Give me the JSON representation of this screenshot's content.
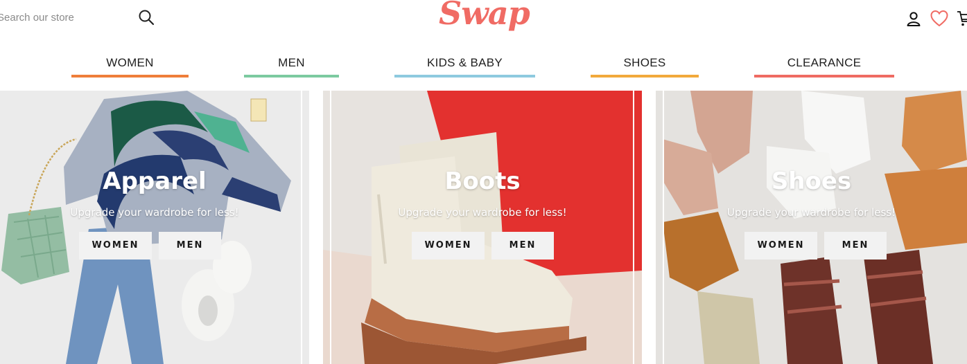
{
  "search": {
    "placeholder": "Search our store",
    "icon": "search-icon"
  },
  "brand": {
    "logo_text": "Swap",
    "color": "#f06b64"
  },
  "header_icons": [
    "account-icon",
    "heart-icon",
    "cart-icon"
  ],
  "nav": [
    {
      "label": "WOMEN",
      "color": "#ef7e3a"
    },
    {
      "label": "MEN",
      "color": "#7ccaa0"
    },
    {
      "label": "KIDS & BABY",
      "color": "#8ecadf"
    },
    {
      "label": "SHOES",
      "color": "#f2a93b"
    },
    {
      "label": "CLEARANCE",
      "color": "#ef6b62"
    }
  ],
  "tiles": [
    {
      "title": "Apparel",
      "subtitle": "Upgrade your wardrobe for less!",
      "buttons": [
        "WOMEN",
        "MEN"
      ]
    },
    {
      "title": "Boots",
      "subtitle": "Upgrade your wardrobe for less!",
      "buttons": [
        "WOMEN",
        "MEN"
      ]
    },
    {
      "title": "Shoes",
      "subtitle": "Upgrade your wardrobe for less!",
      "buttons": [
        "WOMEN",
        "MEN"
      ]
    }
  ]
}
